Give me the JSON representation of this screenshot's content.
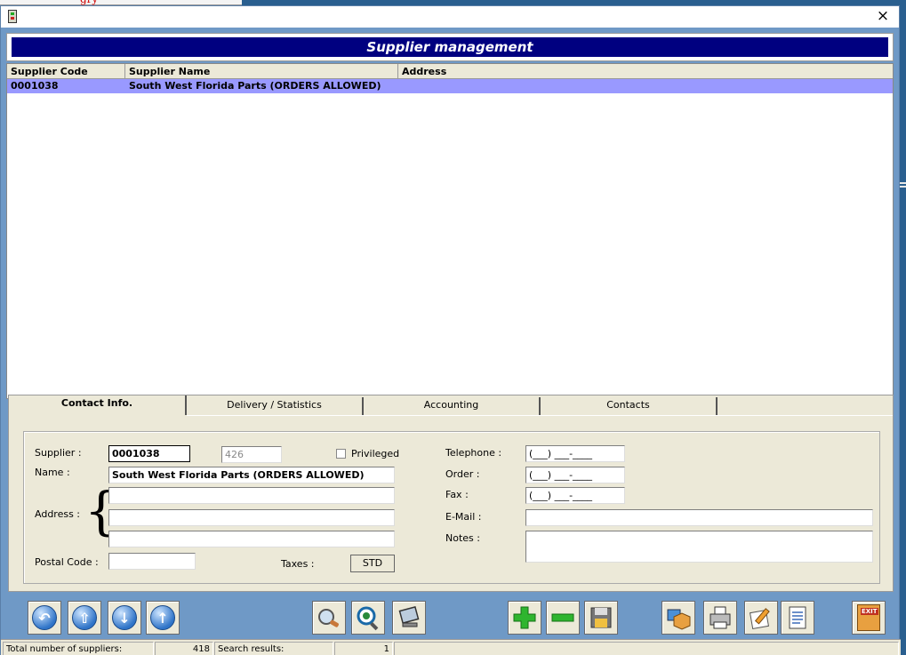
{
  "desktop": {
    "fragment": "gry"
  },
  "window": {
    "close_glyph": "×"
  },
  "banner": {
    "title": "Supplier management"
  },
  "grid": {
    "columns": [
      "Supplier Code",
      "Supplier Name",
      "Address"
    ],
    "rows": [
      {
        "code": "0001038",
        "name": "South West Florida Parts (ORDERS ALLOWED)",
        "address": ""
      }
    ],
    "selected_row_color": "#9999ff"
  },
  "tabs": [
    {
      "label": "Contact Info.",
      "active": true
    },
    {
      "label": "Delivery / Statistics",
      "active": false
    },
    {
      "label": "Accounting",
      "active": false
    },
    {
      "label": "Contacts",
      "active": false
    }
  ],
  "form": {
    "supplier_label": "Supplier :",
    "supplier_value": "0001038",
    "supplier_id_value": "426",
    "privileged_label": "Privileged",
    "privileged_checked": false,
    "name_label": "Name :",
    "name_value": "South West Florida Parts (ORDERS ALLOWED)",
    "address_label": "Address :",
    "address_lines": [
      "",
      "",
      ""
    ],
    "postal_label": "Postal Code :",
    "postal_value": "",
    "taxes_label": "Taxes :",
    "taxes_button": "STD",
    "telephone_label": "Telephone :",
    "telephone_value": "(___) ___-____",
    "order_label": "Order :",
    "order_value": "(___) ___-____",
    "fax_label": "Fax :",
    "fax_value": "(___) ___-____",
    "email_label": "E-Mail :",
    "email_value": "",
    "notes_label": "Notes :",
    "notes_value": ""
  },
  "toolbar": {
    "buttons": [
      {
        "name": "first-record-button",
        "icon": "arrow-left-circle-icon"
      },
      {
        "name": "previous-record-button",
        "icon": "arrow-up-circle-icon"
      },
      {
        "name": "next-record-button",
        "icon": "arrow-down-circle-icon"
      },
      {
        "name": "last-record-button",
        "icon": "arrow-up-circle-icon"
      },
      {
        "name": "search-button",
        "icon": "magnifier-icon"
      },
      {
        "name": "view-button",
        "icon": "eye-magnifier-icon"
      },
      {
        "name": "monitor-button",
        "icon": "monitor-icon"
      },
      {
        "name": "add-button",
        "icon": "plus-icon"
      },
      {
        "name": "delete-button",
        "icon": "minus-icon"
      },
      {
        "name": "save-button",
        "icon": "floppy-disk-icon"
      },
      {
        "name": "package-button",
        "icon": "package-icon"
      },
      {
        "name": "print-button",
        "icon": "printer-icon"
      },
      {
        "name": "edit-note-button",
        "icon": "pencil-note-icon"
      },
      {
        "name": "report-button",
        "icon": "document-icon"
      },
      {
        "name": "exit-button",
        "icon": "exit-door-icon",
        "label": "EXIT"
      }
    ]
  },
  "status": {
    "total_label": "Total number of suppliers:",
    "total_value": "418",
    "search_label": "Search results:",
    "search_value": "1"
  }
}
